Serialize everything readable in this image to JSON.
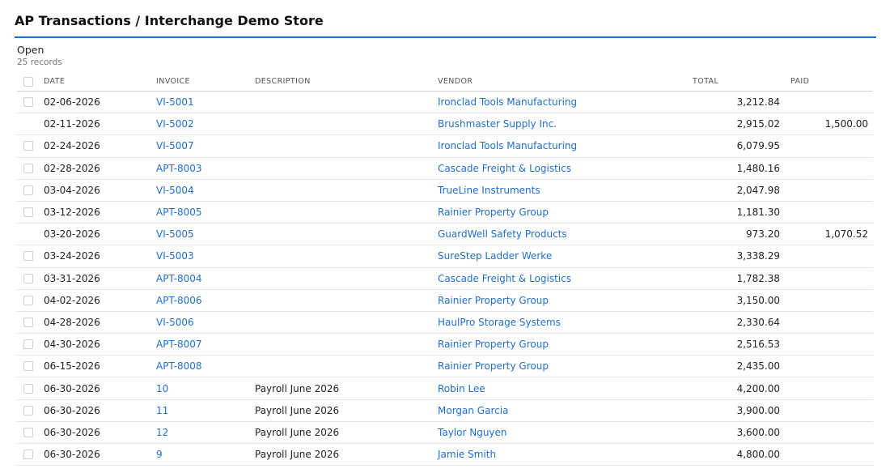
{
  "page": {
    "title": "AP Transactions / Interchange Demo Store",
    "section": "Open",
    "record_count": "25 records"
  },
  "table": {
    "columns": {
      "date": "DATE",
      "invoice": "INVOICE",
      "description": "DESCRIPTION",
      "vendor": "VENDOR",
      "total": "TOTAL",
      "paid": "PAID"
    },
    "rows": [
      {
        "checkbox": true,
        "date": "02-06-2026",
        "invoice": "VI-5001",
        "description": "",
        "vendor": "Ironclad Tools Manufacturing",
        "total": "3,212.84",
        "paid": ""
      },
      {
        "checkbox": false,
        "date": "02-11-2026",
        "invoice": "VI-5002",
        "description": "",
        "vendor": "Brushmaster Supply Inc.",
        "total": "2,915.02",
        "paid": "1,500.00"
      },
      {
        "checkbox": true,
        "date": "02-24-2026",
        "invoice": "VI-5007",
        "description": "",
        "vendor": "Ironclad Tools Manufacturing",
        "total": "6,079.95",
        "paid": ""
      },
      {
        "checkbox": true,
        "date": "02-28-2026",
        "invoice": "APT-8003",
        "description": "",
        "vendor": "Cascade Freight & Logistics",
        "total": "1,480.16",
        "paid": ""
      },
      {
        "checkbox": true,
        "date": "03-04-2026",
        "invoice": "VI-5004",
        "description": "",
        "vendor": "TrueLine Instruments",
        "total": "2,047.98",
        "paid": ""
      },
      {
        "checkbox": true,
        "date": "03-12-2026",
        "invoice": "APT-8005",
        "description": "",
        "vendor": "Rainier Property Group",
        "total": "1,181.30",
        "paid": ""
      },
      {
        "checkbox": false,
        "date": "03-20-2026",
        "invoice": "VI-5005",
        "description": "",
        "vendor": "GuardWell Safety Products",
        "total": "973.20",
        "paid": "1,070.52"
      },
      {
        "checkbox": true,
        "date": "03-24-2026",
        "invoice": "VI-5003",
        "description": "",
        "vendor": "SureStep Ladder Werke",
        "total": "3,338.29",
        "paid": ""
      },
      {
        "checkbox": true,
        "date": "03-31-2026",
        "invoice": "APT-8004",
        "description": "",
        "vendor": "Cascade Freight & Logistics",
        "total": "1,782.38",
        "paid": ""
      },
      {
        "checkbox": true,
        "date": "04-02-2026",
        "invoice": "APT-8006",
        "description": "",
        "vendor": "Rainier Property Group",
        "total": "3,150.00",
        "paid": ""
      },
      {
        "checkbox": true,
        "date": "04-28-2026",
        "invoice": "VI-5006",
        "description": "",
        "vendor": "HaulPro Storage Systems",
        "total": "2,330.64",
        "paid": ""
      },
      {
        "checkbox": true,
        "date": "04-30-2026",
        "invoice": "APT-8007",
        "description": "",
        "vendor": "Rainier Property Group",
        "total": "2,516.53",
        "paid": ""
      },
      {
        "checkbox": true,
        "date": "06-15-2026",
        "invoice": "APT-8008",
        "description": "",
        "vendor": "Rainier Property Group",
        "total": "2,435.00",
        "paid": ""
      },
      {
        "checkbox": true,
        "date": "06-30-2026",
        "invoice": "10",
        "description": "Payroll June 2026",
        "vendor": "Robin Lee",
        "total": "4,200.00",
        "paid": ""
      },
      {
        "checkbox": true,
        "date": "06-30-2026",
        "invoice": "11",
        "description": "Payroll June 2026",
        "vendor": "Morgan Garcia",
        "total": "3,900.00",
        "paid": ""
      },
      {
        "checkbox": true,
        "date": "06-30-2026",
        "invoice": "12",
        "description": "Payroll June 2026",
        "vendor": "Taylor Nguyen",
        "total": "3,600.00",
        "paid": ""
      },
      {
        "checkbox": true,
        "date": "06-30-2026",
        "invoice": "9",
        "description": "Payroll June 2026",
        "vendor": "Jamie Smith",
        "total": "4,800.00",
        "paid": ""
      }
    ]
  },
  "colors": {
    "accent": "#1f6fd1",
    "link": "#1f6fd1",
    "row_divider": "#e4e4e4"
  }
}
